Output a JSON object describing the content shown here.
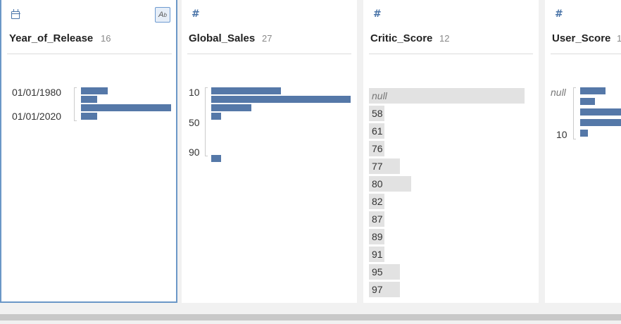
{
  "columns": [
    {
      "name": "Year_of_Release",
      "count": "16",
      "type": "date",
      "axis": [
        "01/01/1980",
        "01/01/2020"
      ],
      "bars": [
        0.3,
        0.18,
        1.0,
        0.18
      ]
    },
    {
      "name": "Global_Sales",
      "count": "27",
      "type": "number",
      "axis": [
        "10",
        "50",
        "90"
      ],
      "bars": [
        0.5,
        1.0,
        0.29,
        0.07,
        0,
        0,
        0,
        0,
        0.07
      ]
    },
    {
      "name": "Critic_Score",
      "count": "12",
      "type": "number",
      "values": [
        {
          "label": "null",
          "weight": 1.0
        },
        {
          "label": "58",
          "weight": 0.1
        },
        {
          "label": "61",
          "weight": 0.1
        },
        {
          "label": "76",
          "weight": 0.1
        },
        {
          "label": "77",
          "weight": 0.2
        },
        {
          "label": "80",
          "weight": 0.27
        },
        {
          "label": "82",
          "weight": 0.1
        },
        {
          "label": "87",
          "weight": 0.1
        },
        {
          "label": "89",
          "weight": 0.1
        },
        {
          "label": "91",
          "weight": 0.1
        },
        {
          "label": "95",
          "weight": 0.2
        },
        {
          "label": "97",
          "weight": 0.2
        }
      ]
    },
    {
      "name": "User_Score",
      "count": "1",
      "type": "number",
      "axis": [
        "null",
        "10"
      ],
      "bars": [
        0.6,
        0.35,
        1.0,
        1.0,
        0.18
      ]
    }
  ],
  "icons": {
    "date": "calendar-icon",
    "number": "hash-icon",
    "ab": "abc-type-icon"
  },
  "colors": {
    "accent": "#4a74a8",
    "bar": "#5578a8",
    "selected_border": "#6b97c7"
  }
}
